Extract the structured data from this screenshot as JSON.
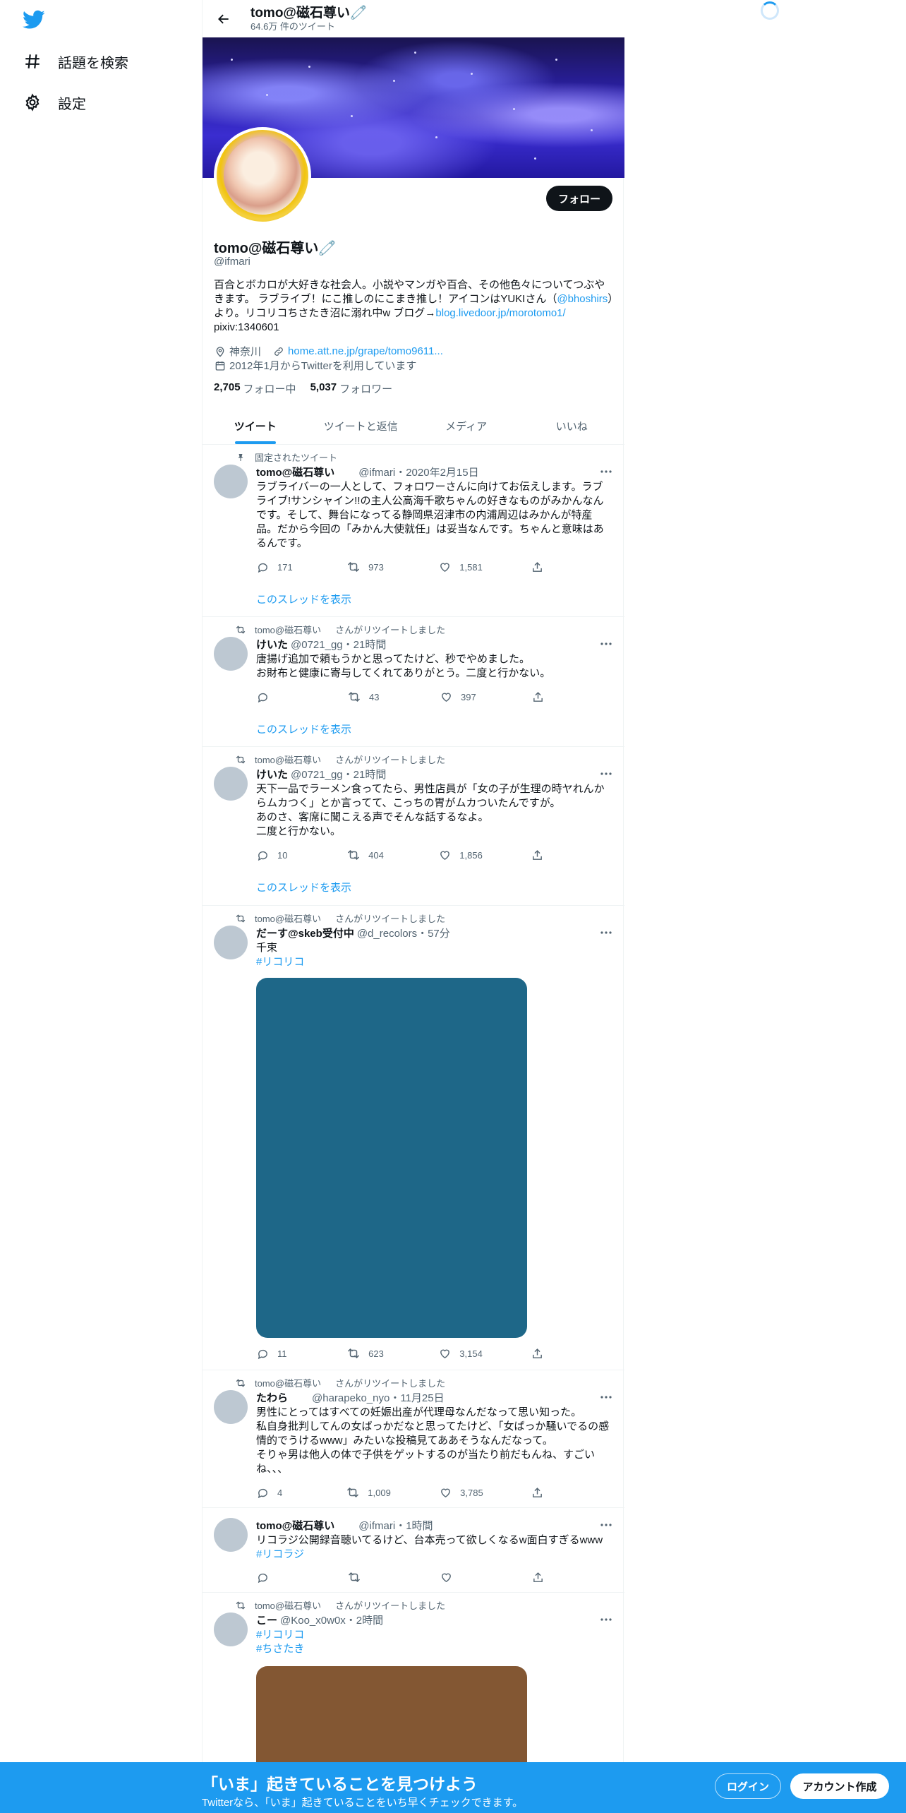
{
  "nav": {
    "logo": "twitter-bird",
    "items": [
      {
        "icon": "hashtag-icon",
        "label": "話題を検索"
      },
      {
        "icon": "gear-icon",
        "label": "設定"
      }
    ]
  },
  "header": {
    "title": "tomo@磁石尊い🧷",
    "tweet_count": "64.6万 件のツイート"
  },
  "profile": {
    "follow_label": "フォロー",
    "name": "tomo@磁石尊い🧷",
    "handle": "@ifmari",
    "bio_text_1": "百合とボカロが大好きな社会人。小説やマンガや百合、その他色々についてつぶやきます。 ラブライブ！にこ推しのにこまき推し！アイコンはYUKIさん（",
    "bio_mention": "@bhoshirs",
    "bio_text_2": "）より。リコリコちさたき沼に溺れ中w ブログ→",
    "bio_link": "blog.livedoor.jp/morotomo1/",
    "bio_text_3": "pixiv:1340601",
    "location": "神奈川",
    "url": "home.att.ne.jp/grape/tomo9611...",
    "joined": "2012年1月からTwitterを利用しています",
    "following_count": "2,705",
    "following_label": "フォロー中",
    "followers_count": "5,037",
    "followers_label": "フォロワー"
  },
  "tabs": [
    "ツイート",
    "ツイートと返信",
    "メディア",
    "いいね"
  ],
  "active_tab": 0,
  "tweets": [
    {
      "context": "固定されたツイート",
      "name": "tomo@磁石尊い",
      "handle": "@ifmari",
      "time": "・2020年2月15日",
      "text": "ラブライバーの一人として、フォロワーさんに向けてお伝えします。ラブライブ!サンシャイン!!の主人公高海千歌ちゃんの好きなものがみかんなんです。そして、舞台になってる静岡県沼津市の内浦周辺はみかんが特産品。だから今回の「みかん大使就任」は妥当なんです。ちゃんと意味はあるんです。",
      "replies": "171",
      "retweets": "973",
      "likes": "1,581",
      "thread": "このスレッドを表示"
    },
    {
      "context_user": "tomo@磁石尊い",
      "context": "さんがリツイートしました",
      "name": "けいた",
      "handle": "@0721_gg",
      "time": "・21時間",
      "text": "唐揚げ追加で頼もうかと思ってたけど、秒でやめました。\nお財布と健康に寄与してくれてありがとう。二度と行かない。",
      "replies": "",
      "retweets": "43",
      "likes": "397",
      "thread": "このスレッドを表示"
    },
    {
      "context_user": "tomo@磁石尊い",
      "context": "さんがリツイートしました",
      "name": "けいた",
      "handle": "@0721_gg",
      "time": "・21時間",
      "text": "天下一品でラーメン食ってたら、男性店員が「女の子が生理の時ヤれんからムカつく」とか言ってて、こっちの胃がムカついたんですが。\nあのさ、客席に聞こえる声でそんな話するなよ。\n二度と行かない。",
      "replies": "10",
      "retweets": "404",
      "likes": "1,856",
      "thread": "このスレッドを表示"
    },
    {
      "context_user": "tomo@磁石尊い",
      "context": "さんがリツイートしました",
      "name": "だーす@skeb受付中",
      "handle": "@d_recolors",
      "time": "・57分",
      "text": "千束",
      "tag": "#リコリコ",
      "media_color": "#1e6788",
      "replies": "11",
      "retweets": "623",
      "likes": "3,154"
    },
    {
      "context_user": "tomo@磁石尊い",
      "context": "さんがリツイートしました",
      "name": "たわら",
      "handle": "@harapeko_nyo",
      "time": "・11月25日",
      "text": "男性にとってはすべての妊娠出産が代理母なんだなって思い知った。\n私自身批判してんの女ばっかだなと思ってたけど、「女ばっか騒いでるの感情的でうけるwww」みたいな投稿見てああそうなんだなって。\nそりゃ男は他人の体で子供をゲットするのが当たり前だもんね、すごいね、、、",
      "replies": "4",
      "retweets": "1,009",
      "likes": "3,785"
    },
    {
      "name": "tomo@磁石尊い",
      "handle": "@ifmari",
      "time": "・1時間",
      "text": "リコラジ公開録音聴いてるけど、台本売って欲しくなるw面白すぎるwww",
      "tag": "#リコラジ",
      "replies": "",
      "retweets": "",
      "likes": ""
    },
    {
      "context_user": "tomo@磁石尊い",
      "context": "さんがリツイートしました",
      "name": "こー",
      "handle": "@Koo_x0w0x",
      "time": "・2時間",
      "tag": "#リコリコ",
      "tag2": "#ちさたき",
      "media_color": "#835733"
    }
  ],
  "bottom": {
    "title": "「いま」起きていることを見つけよう",
    "subtitle": "Twitterなら、「いま」起きていることをいち早くチェックできます。",
    "login": "ログイン",
    "signup": "アカウント作成"
  },
  "colors": {
    "accent": "#1d9bf0",
    "dark": "#0f1419",
    "muted": "#536471"
  }
}
